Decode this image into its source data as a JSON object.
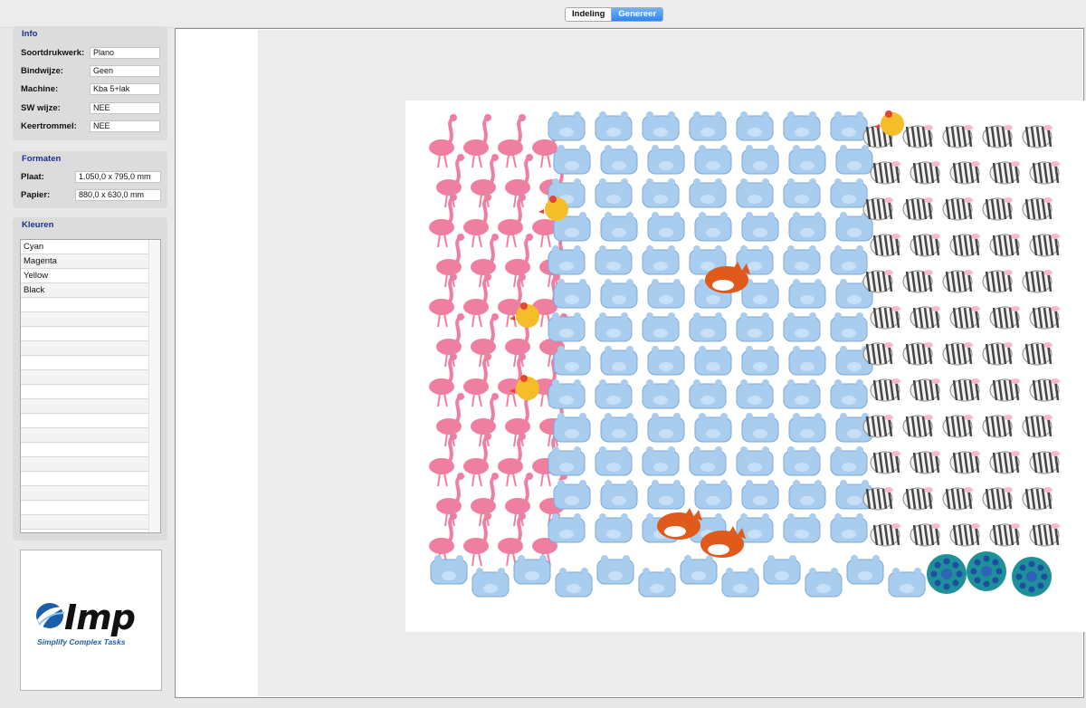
{
  "tabs": [
    {
      "label": "Indeling",
      "active": false
    },
    {
      "label": "Genereer",
      "active": true
    }
  ],
  "info": {
    "title": "Info",
    "fields": [
      {
        "label": "Soortdrukwerk:",
        "value": "Plano"
      },
      {
        "label": "Bindwijze:",
        "value": "Geen"
      },
      {
        "label": "Machine:",
        "value": "Kba 5+lak"
      },
      {
        "label": "SW wijze:",
        "value": "NEE"
      },
      {
        "label": "Keertrommel:",
        "value": "NEE"
      }
    ]
  },
  "formats": {
    "title": "Formaten",
    "fields": [
      {
        "label": "Plaat:",
        "value": "1.050,0 x 795,0 mm"
      },
      {
        "label": "Papier:",
        "value": "880,0 x 630,0 mm"
      }
    ]
  },
  "colors": {
    "title": "Kleuren",
    "items": [
      "Cyan",
      "Magenta",
      "Yellow",
      "Black"
    ],
    "empty_rows": 16
  },
  "logo": {
    "name": "Imp",
    "tagline": "Simplify Complex Tasks",
    "colors": {
      "blue": "#1b5ea8",
      "dark": "#111111"
    }
  },
  "artwork": {
    "groups": [
      {
        "name": "flamingo",
        "color": "#ef7fa0"
      },
      {
        "name": "hippo",
        "color": "#a8cdef"
      },
      {
        "name": "zebra",
        "color": "#444444"
      },
      {
        "name": "fox",
        "color": "#e05a1c"
      },
      {
        "name": "chick",
        "color": "#f5bd2a"
      },
      {
        "name": "peacock",
        "color": "#1f8f9a"
      }
    ]
  },
  "theme": {
    "accent": "#2f86f0",
    "group_title": "#1c2f8f"
  }
}
